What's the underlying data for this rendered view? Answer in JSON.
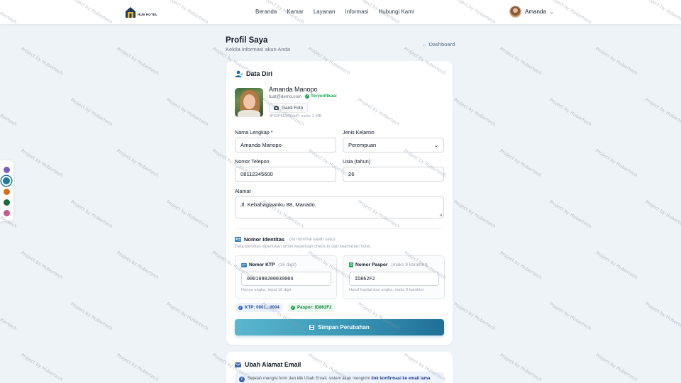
{
  "navbar": {
    "logo_text": "HUB HOTEL",
    "links": [
      "Beranda",
      "Kamar",
      "Layanan",
      "Informasi",
      "Hubungi Kami"
    ],
    "user_name": "Amanda"
  },
  "palette": {
    "colors": [
      "#7c5cc4",
      "#1f7a99",
      "#d96f1e",
      "#1e6b3a",
      "#c95a8c"
    ],
    "selected_index": 1
  },
  "header": {
    "title": "Profil Saya",
    "subtitle": "Kelola informasi akun Anda",
    "back_link": "Dashboard"
  },
  "personal": {
    "section_title": "Data Diri",
    "name": "Amanda Manopo",
    "email": "tuat@demo.com",
    "verified_label": "Terverifikasi",
    "change_photo_label": "Ganti Foto",
    "photo_hint": "JPG/PNG/WebP, maks 1 MB",
    "fields": {
      "fullname_label": "Nama Lengkap *",
      "fullname_value": "Amanda Manopo",
      "gender_label": "Jenis Kelamin",
      "gender_value": "Perempuan",
      "phone_label": "Nomor Telepon",
      "phone_value": "08112345600",
      "age_label": "Usia (tahun)",
      "age_value": "26",
      "address_label": "Alamat",
      "address_value": "Jl. Kebahagiaanku 88, Manado."
    }
  },
  "identity": {
    "title": "Nomor Identitas",
    "title_note": "(isi minimal salah satu)",
    "description": "Data identitas diperlukan untuk keperluan check-in dan keamanan hotel.",
    "ktp": {
      "label": "Nomor KTP",
      "note": "(16 digit)",
      "value": "0001000200030004",
      "hint": "Hanya angka, tepat 16 digit"
    },
    "passport": {
      "label": "Nomor Paspor",
      "note": "(maks 9 karakter)",
      "value": "ID862F2",
      "hint": "Huruf kapital dan angka, maks 9 karakter"
    },
    "chip_ktp": "KTP: 0001...0004",
    "chip_passport": "Paspor: ID862F2"
  },
  "save_label": "Simpan Perubahan",
  "email_section": {
    "title": "Ubah Alamat Email",
    "notice_text": "Setelah mengisi form dan klik Ubah Email, sistem akan mengirim",
    "notice_bold": "link konfirmasi ke email lama"
  },
  "watermark": "Project by Hubertech"
}
